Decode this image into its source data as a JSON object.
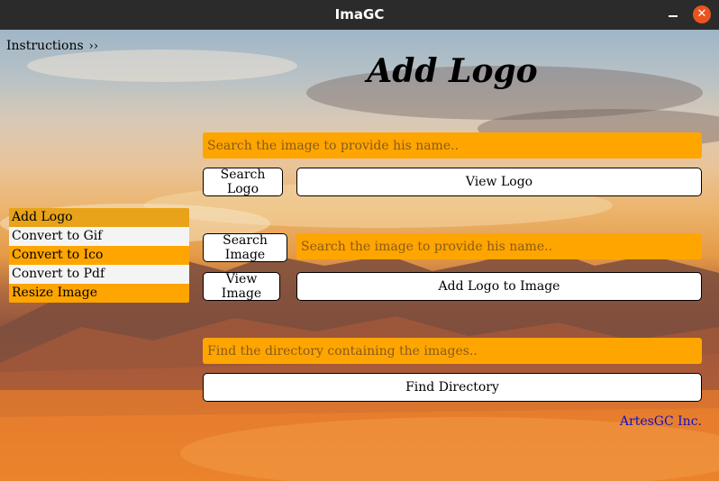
{
  "window": {
    "title": "ImaGC",
    "minimize_label": "—",
    "close_label": "✕"
  },
  "menu": {
    "instructions_label": "Instructions",
    "chevron": "››"
  },
  "page": {
    "heading": "Add Logo"
  },
  "sidebar": {
    "items": [
      {
        "label": "Add Logo",
        "state": "selected"
      },
      {
        "label": "Convert to Gif",
        "state": "normal"
      },
      {
        "label": "Convert to Ico",
        "state": "normal"
      },
      {
        "label": "Convert to Pdf",
        "state": "normal"
      },
      {
        "label": "Resize Image",
        "state": "normal"
      }
    ]
  },
  "logo_section": {
    "search_placeholder": "Search the image to provide his name..",
    "search_button": "Search Logo",
    "view_button": "View Logo"
  },
  "image_section": {
    "search_button": "Search Image",
    "search_placeholder": "Search the image to provide his name..",
    "view_button": "View Image",
    "add_button": "Add Logo to Image"
  },
  "directory_section": {
    "placeholder": "Find the directory containing the images..",
    "button": "Find Directory"
  },
  "footer": {
    "credit": "ArtesGC Inc."
  },
  "colors": {
    "accent_orange": "#ffa500",
    "selected_item": "#e8a31a",
    "footer_link": "#1010c8",
    "titlebar": "#2b2b2b",
    "close_button": "#e95420"
  }
}
